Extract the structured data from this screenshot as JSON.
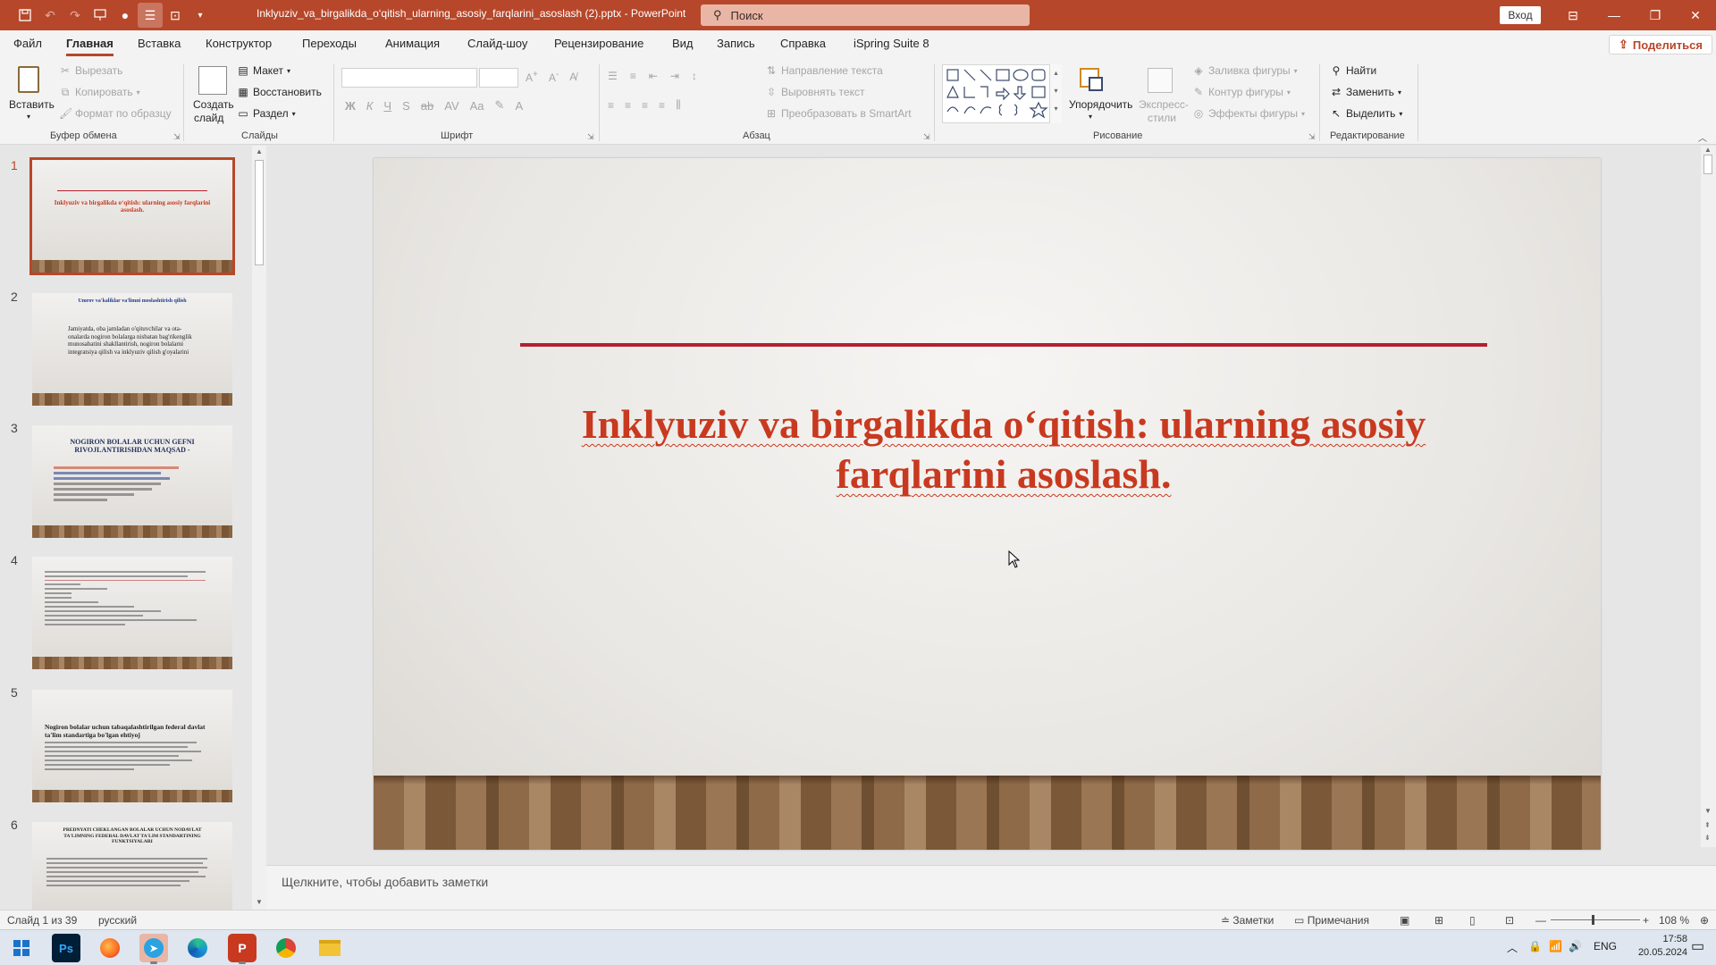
{
  "titlebar": {
    "document_title": "Inklyuziv_va_birgalikda_o‘qitish_ularning_asosiy_farqlarini_asoslash (2).pptx  -  PowerPoint",
    "search_placeholder": "Поиск",
    "signin_label": "Вход"
  },
  "menu": {
    "tabs": [
      "Файл",
      "Главная",
      "Вставка",
      "Конструктор",
      "Переходы",
      "Анимация",
      "Слайд-шоу",
      "Рецензирование",
      "Вид",
      "Запись",
      "Справка",
      "iSpring Suite 8"
    ],
    "active_tab": "Главная",
    "share_label": "Поделиться"
  },
  "ribbon": {
    "clipboard": {
      "label": "Буфер обмена",
      "paste": "Вставить",
      "cut": "Вырезать",
      "copy": "Копировать",
      "format_painter": "Формат по образцу"
    },
    "slides": {
      "label": "Слайды",
      "new_slide_line1": "Создать",
      "new_slide_line2": "слайд",
      "layout": "Макет",
      "reset": "Восстановить",
      "section": "Раздел"
    },
    "font": {
      "label": "Шрифт"
    },
    "paragraph": {
      "label": "Абзац",
      "text_direction": "Направление текста",
      "align_text": "Выровнять текст",
      "convert_smartart": "Преобразовать в SmartArt"
    },
    "drawing": {
      "label": "Рисование",
      "arrange": "Упорядочить",
      "quick_styles_line1": "Экспресс-",
      "quick_styles_line2": "стили",
      "shape_fill": "Заливка фигуры",
      "shape_outline": "Контур фигуры",
      "shape_effects": "Эффекты фигуры"
    },
    "editing": {
      "label": "Редактирование",
      "find": "Найти",
      "replace": "Заменить",
      "select": "Выделить"
    }
  },
  "thumbnails": [
    {
      "number": "1",
      "text": "Inklyuziv va birgalikda o‘qitish: ularning asosiy farqlarini asoslash."
    },
    {
      "number": "2",
      "heading": "Umrov va'kaliklar va'limni moslashtirish qilish",
      "text": "Jamiyatda, oba jamladan o'qituvchilar va ota-onalarda nogiron bolalarga nisbatan bag'rikenglik munosabatini shakllantirish, nogiron bolalarni integratsiya qilish va inklyuziv qilish g'oyalarini"
    },
    {
      "number": "3",
      "heading": "NOGIRON BOLALAR UCHUN GEFNI RIVOJLANTIRISHDAN MAQSAD -"
    },
    {
      "number": "4"
    },
    {
      "number": "5",
      "heading": "Nogiron bolalar uchun tabaqalashtirilgan federal davlat ta'lim standartiga bo'lgan ehtiyoj"
    },
    {
      "number": "6",
      "heading": "PREDNYATI CHEKLANGAN BOLALAR UCHUN NODAVLAT TA'LIMNING FEDERAL DAVLAT TA'LIM STANDARTINING FUNKTSIYALARI"
    }
  ],
  "slide": {
    "title": "Inklyuziv va birgalikda o‘qitish: ularning asosiy farqlarini asoslash.",
    "title_color": "#c8391f",
    "accent_line_color": "#b42032"
  },
  "notes_placeholder": "Щелкните, чтобы добавить заметки",
  "status": {
    "slide_counter": "Слайд 1 из 39",
    "language": "русский",
    "notes_btn": "Заметки",
    "comments_btn": "Примечания",
    "zoom": "108 %"
  },
  "taskbar": {
    "lang": "ENG",
    "time": "17:58",
    "date": "20.05.2024"
  },
  "colors": {
    "brand": "#b7472a"
  }
}
